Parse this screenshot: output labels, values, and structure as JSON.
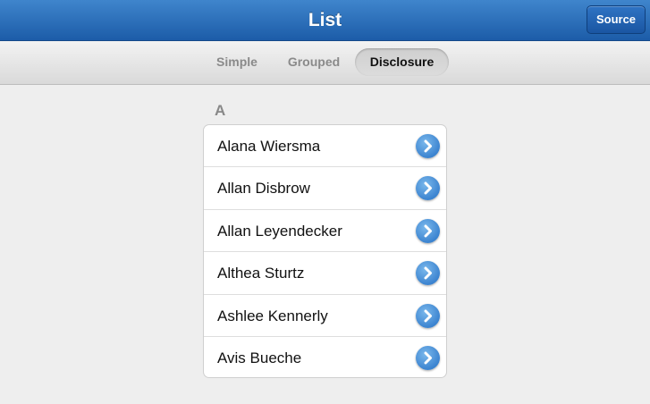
{
  "header": {
    "title": "List",
    "source_label": "Source"
  },
  "tabs": [
    {
      "label": "Simple",
      "selected": false
    },
    {
      "label": "Grouped",
      "selected": false
    },
    {
      "label": "Disclosure",
      "selected": true
    }
  ],
  "section": {
    "header": "A",
    "items": [
      {
        "label": "Alana Wiersma",
        "icon": "disclosure-chevron-icon"
      },
      {
        "label": "Allan Disbrow",
        "icon": "disclosure-chevron-icon"
      },
      {
        "label": "Allan Leyendecker",
        "icon": "disclosure-chevron-icon"
      },
      {
        "label": "Althea Sturtz",
        "icon": "disclosure-chevron-icon"
      },
      {
        "label": "Ashlee Kennerly",
        "icon": "disclosure-chevron-icon"
      },
      {
        "label": "Avis Bueche",
        "icon": "disclosure-chevron-icon"
      }
    ]
  },
  "colors": {
    "titlebar": "#2a6dbb",
    "accent": "#3c84d0"
  }
}
